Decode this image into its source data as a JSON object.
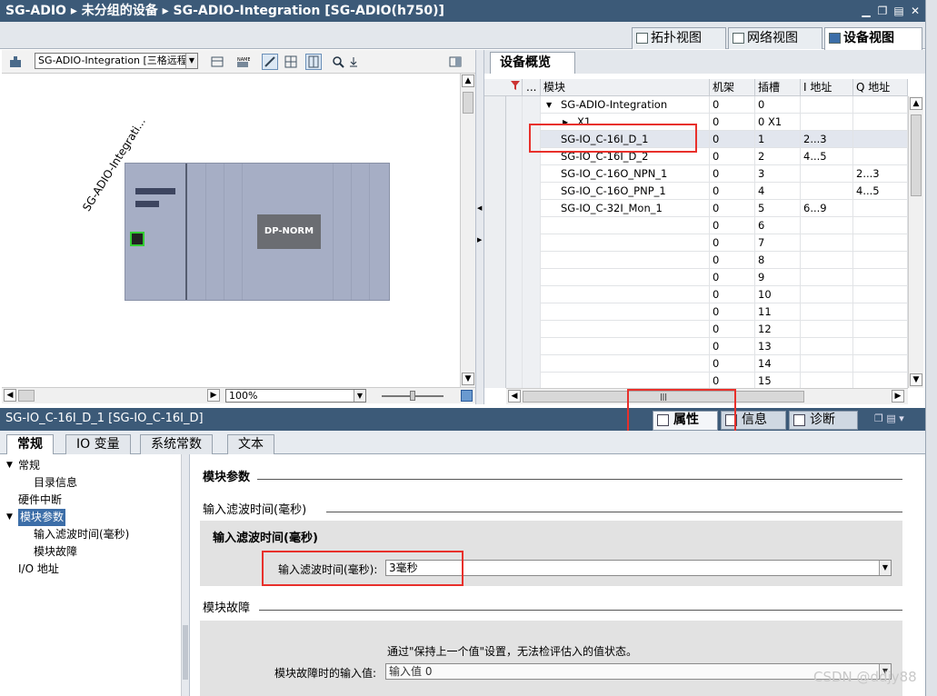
{
  "window": {
    "title": "SG-ADIO  ▸  未分组的设备  ▸  SG-ADIO-Integration [SG-ADIO(h750)]"
  },
  "view_tabs": [
    {
      "label": "拓扑视图",
      "icon": "topology-view-icon"
    },
    {
      "label": "网络视图",
      "icon": "network-view-icon"
    },
    {
      "label": "设备视图",
      "icon": "device-view-icon",
      "active": true
    }
  ],
  "left_editor": {
    "device_selector": "SG-ADIO-Integration [三格远程",
    "device_label": "SG-ADIO-Integrati...",
    "module_label": "DP-NORM",
    "zoom": "100%"
  },
  "overview": {
    "tab_label": "设备概览",
    "columns": [
      "模块",
      "机架",
      "插槽",
      "I 地址",
      "Q 地址"
    ],
    "rows": [
      {
        "module": "SG-ADIO-Integration",
        "rack": "0",
        "slot": "0",
        "i": "",
        "q": "",
        "indent": 1,
        "expand": "▼"
      },
      {
        "module": "X1",
        "rack": "0",
        "slot": "0 X1",
        "i": "",
        "q": "",
        "indent": 2,
        "expand": "▶"
      },
      {
        "module": "SG-IO_C-16I_D_1",
        "rack": "0",
        "slot": "1",
        "i": "2...3",
        "q": "",
        "indent": 1,
        "selected": true
      },
      {
        "module": "SG-IO_C-16I_D_2",
        "rack": "0",
        "slot": "2",
        "i": "4...5",
        "q": "",
        "indent": 1
      },
      {
        "module": "SG-IO_C-16O_NPN_1",
        "rack": "0",
        "slot": "3",
        "i": "",
        "q": "2...3",
        "indent": 1
      },
      {
        "module": "SG-IO_C-16O_PNP_1",
        "rack": "0",
        "slot": "4",
        "i": "",
        "q": "4...5",
        "indent": 1
      },
      {
        "module": "SG-IO_C-32I_Mon_1",
        "rack": "0",
        "slot": "5",
        "i": "6...9",
        "q": "",
        "indent": 1
      },
      {
        "module": "",
        "rack": "0",
        "slot": "6",
        "i": "",
        "q": ""
      },
      {
        "module": "",
        "rack": "0",
        "slot": "7",
        "i": "",
        "q": ""
      },
      {
        "module": "",
        "rack": "0",
        "slot": "8",
        "i": "",
        "q": ""
      },
      {
        "module": "",
        "rack": "0",
        "slot": "9",
        "i": "",
        "q": ""
      },
      {
        "module": "",
        "rack": "0",
        "slot": "10",
        "i": "",
        "q": ""
      },
      {
        "module": "",
        "rack": "0",
        "slot": "11",
        "i": "",
        "q": ""
      },
      {
        "module": "",
        "rack": "0",
        "slot": "12",
        "i": "",
        "q": ""
      },
      {
        "module": "",
        "rack": "0",
        "slot": "13",
        "i": "",
        "q": ""
      },
      {
        "module": "",
        "rack": "0",
        "slot": "14",
        "i": "",
        "q": ""
      },
      {
        "module": "",
        "rack": "0",
        "slot": "15",
        "i": "",
        "q": ""
      }
    ]
  },
  "properties": {
    "title": "SG-IO_C-16I_D_1 [SG-IO_C-16I_D]",
    "tabs": [
      {
        "label": "属性",
        "icon": "properties-icon",
        "active": true
      },
      {
        "label": "信息",
        "icon": "info-icon"
      },
      {
        "label": "诊断",
        "icon": "diagnostics-icon"
      }
    ],
    "subtabs": [
      "常规",
      "IO 变量",
      "系统常数",
      "文本"
    ],
    "tree": [
      {
        "label": "常规",
        "level": 0,
        "expand": "▼"
      },
      {
        "label": "目录信息",
        "level": 1
      },
      {
        "label": "硬件中断",
        "level": 0
      },
      {
        "label": "模块参数",
        "level": 0,
        "expand": "▼",
        "selected": true
      },
      {
        "label": "输入滤波时间(毫秒)",
        "level": 1
      },
      {
        "label": "模块故障",
        "level": 1
      },
      {
        "label": "I/O 地址",
        "level": 0
      }
    ],
    "content": {
      "section_title": "模块参数",
      "filter_section": "输入滤波时间(毫秒)",
      "filter_panel_title": "输入滤波时间(毫秒)",
      "filter_field_label": "输入滤波时间(毫秒):",
      "filter_field_value": "3毫秒",
      "fault_section": "模块故障",
      "fault_note": "通过\"保持上一个值\"设置，无法检评估入的值状态。",
      "fault_field_label": "模块故障时的输入值:",
      "fault_field_value": "输入值 0"
    }
  },
  "watermark": "CSDN @ddjy88",
  "colors": {
    "titlebar": "#3c5a78",
    "highlight": "#e8302b",
    "selection": "#3c6ea8"
  }
}
